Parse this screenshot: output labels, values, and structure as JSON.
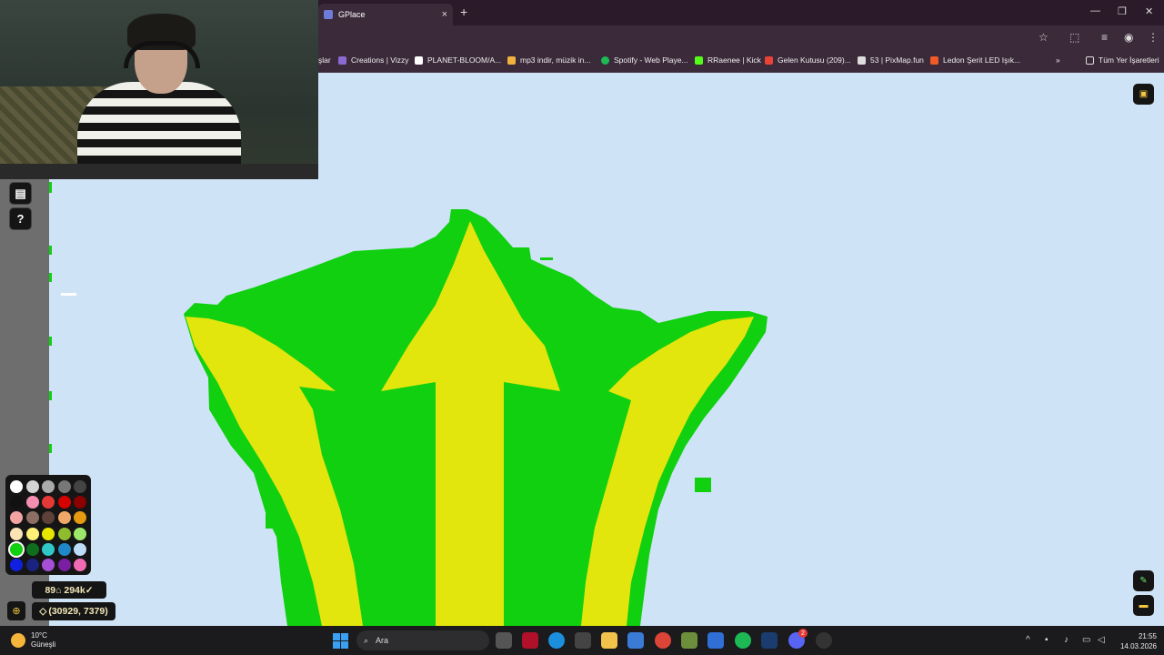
{
  "browser": {
    "tab_title": "GPlace",
    "new_tab": "+",
    "tab_close": "×",
    "bookmarks": [
      {
        "label": "şlar",
        "color": "#8a8a8a"
      },
      {
        "label": "Creations | Vizzy",
        "color": "#8b6ad1"
      },
      {
        "label": "PLANET-BLOOM/A...",
        "color": "#ffffff"
      },
      {
        "label": "mp3 indir, müzik in...",
        "color": "#f2b23e"
      },
      {
        "label": "Spotify - Web Playe...",
        "color": "#1db954"
      },
      {
        "label": "RRaenee | Kick",
        "color": "#53fc18"
      },
      {
        "label": "Gelen Kutusu (209)...",
        "color": "#ea4335"
      },
      {
        "label": "53 | PixMap.fun",
        "color": "#dddddd"
      },
      {
        "label": "Ledon Şerit LED Işık...",
        "color": "#f05a28"
      }
    ],
    "bookmarks_overflow": "»",
    "all_bookmarks": "Tüm Yer İşaretleri"
  },
  "game": {
    "help_label": "?",
    "pixel_counter": "89⌂ 294k✓",
    "coordinates": "(30929, 7379)",
    "palette": [
      "#ffffff",
      "#d4d4d4",
      "#aaaaaa",
      "#777777",
      "#444444",
      "#111111",
      "#f48fb1",
      "#e53935",
      "#d50000",
      "#8b0000",
      "#f4a3a3",
      "#8d6e63",
      "#5d4037",
      "#f0a868",
      "#e69a10",
      "#fbe3b5",
      "#fff176",
      "#e6e600",
      "#8fbc2f",
      "#9de86a",
      "#10d010",
      "#0f6e1e",
      "#2fc7c7",
      "#1e88c8",
      "#bcdcf7",
      "#1020e0",
      "#1a237e",
      "#a64fd6",
      "#7b1fa2",
      "#f06ab4"
    ],
    "selected_color_index": 20
  },
  "taskbar": {
    "temperature": "10°C",
    "weather_desc": "Güneşli",
    "search_placeholder": "Ara",
    "time": "21:55",
    "date": "14.03.2026",
    "discord_badge": "2"
  }
}
